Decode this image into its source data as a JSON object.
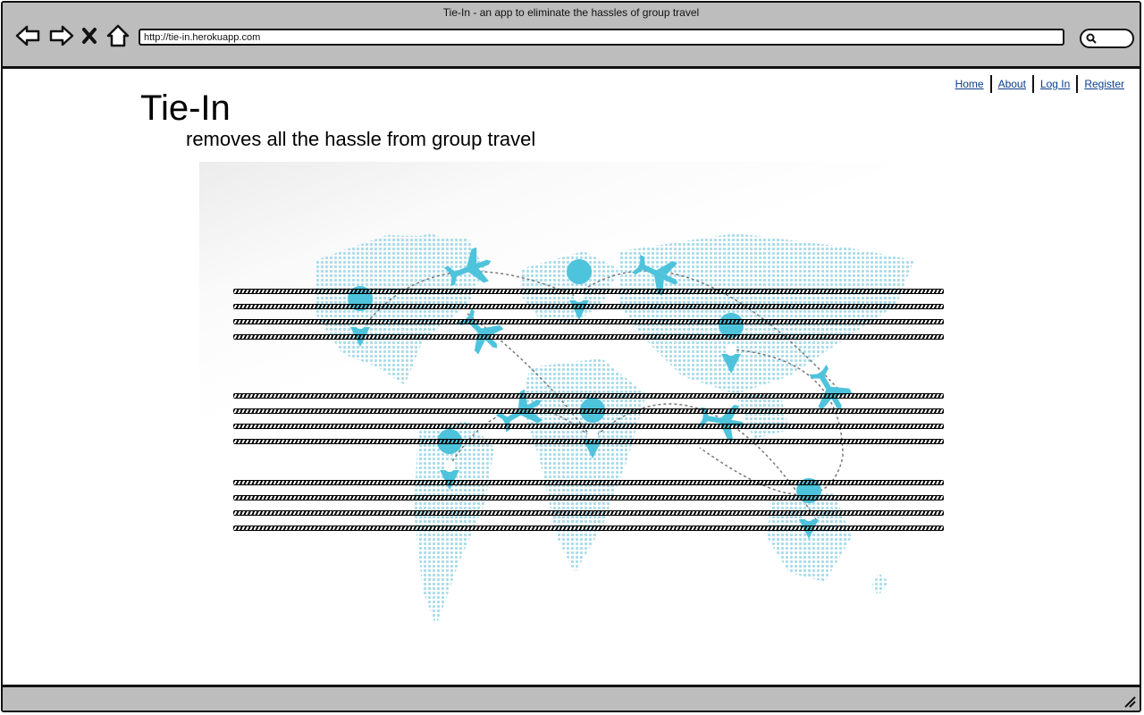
{
  "browser": {
    "window_title": "Tie-In - an app to eliminate the hassles of group travel",
    "url": "http://tie-in.herokuapp.com",
    "nav_icons": [
      "back-arrow-icon",
      "forward-arrow-icon",
      "stop-icon",
      "home-icon"
    ],
    "search_icon": "search-icon"
  },
  "nav": {
    "home": "Home",
    "about": "About",
    "login": "Log In",
    "register": "Register"
  },
  "header": {
    "title": "Tie-In",
    "tagline": "removes all the hassle from group travel"
  },
  "hero": {
    "accent_color": "#4ec3dc",
    "map_color": "#a9dcea",
    "paragraph_count": 3
  }
}
